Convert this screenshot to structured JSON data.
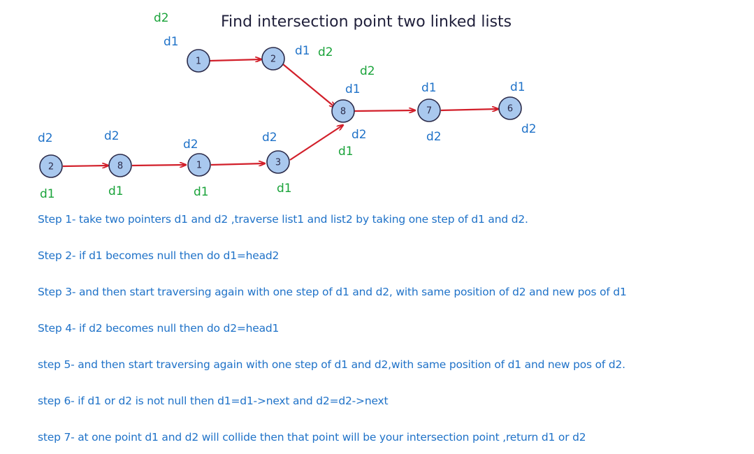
{
  "title": "Find intersection point two linked lists",
  "nodes": {
    "a1": "1",
    "a2": "2",
    "c8": "8",
    "c7": "7",
    "c6": "6",
    "b2": "2",
    "b8": "8",
    "b1": "1",
    "b3": "3"
  },
  "labels": {
    "top_d2_green": "d2",
    "top_d1_blue": "d1",
    "n2_d1": "d1",
    "n2_d2": "d2",
    "n8_d2_green": "d2",
    "n8_d1": "d1",
    "n7_d1": "d1",
    "n6_d1": "d1",
    "b2_d2": "d2",
    "b8_d2": "d2",
    "b1_d2": "d2",
    "b3_d2": "d2",
    "n8_below_d2": "d2",
    "n8_below_d1_green": "d1",
    "n7_d2": "d2",
    "n6_d2": "d2",
    "b2_d1": "d1",
    "b8_d1": "d1",
    "b1_d1": "d1",
    "b3_d1": "d1"
  },
  "steps": [
    "Step 1- take two pointers d1 and d2 ,traverse list1 and list2 by taking one step of d1 and d2.",
    "Step 2- if d1 becomes null then do d1=head2",
    "Step 3- and then start traversing again with one step of d1 and d2, with same position of d2 and new pos of d1",
    "Step 4- if d2 becomes null then do d2=head1",
    "step 5- and then start traversing again with one step of d1 and d2,with same position of d1 and new pos of d2.",
    "step 6- if d1 or d2  is not null then d1=d1->next and d2=d2->next",
    "step 7- at one point d1 and d2 will collide then that point will be your intersection point  ,return d1 or d2"
  ],
  "colors": {
    "edge": "#d21f2a",
    "node_fill": "#a9c8ee",
    "label_blue": "#1f72c8",
    "label_green": "#1aa33a",
    "step_text": "#1f72c8"
  }
}
